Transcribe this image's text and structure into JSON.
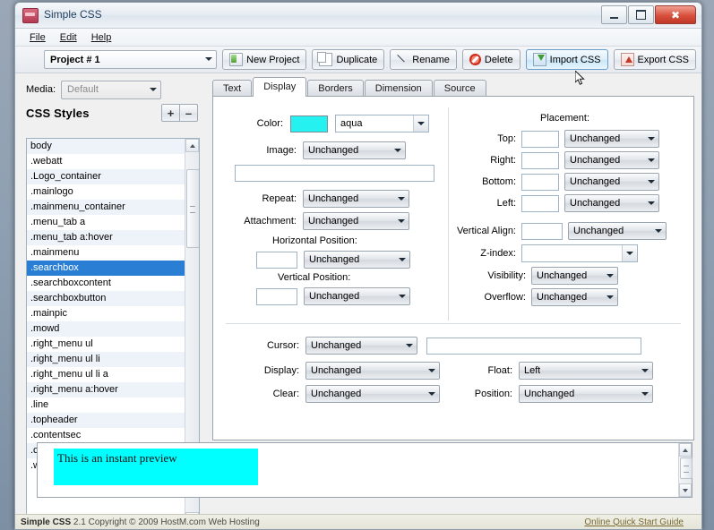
{
  "window": {
    "title": "Simple CSS",
    "app_icon": "app-icon",
    "minimize_label": "Minimize",
    "maximize_label": "Maximize",
    "close_label": "Close"
  },
  "menubar": {
    "items": [
      "File",
      "Edit",
      "Help"
    ]
  },
  "toolbar": {
    "project_value": "Project # 1",
    "buttons": [
      {
        "label": "New Project",
        "icon": "new-project-icon",
        "hover": false
      },
      {
        "label": "Duplicate",
        "icon": "duplicate-icon",
        "hover": false
      },
      {
        "label": "Rename",
        "icon": "rename-icon",
        "hover": false
      },
      {
        "label": "Delete",
        "icon": "delete-icon",
        "hover": false
      },
      {
        "label": "Import CSS",
        "icon": "import-icon",
        "hover": true
      },
      {
        "label": "Export CSS",
        "icon": "export-icon",
        "hover": false
      }
    ]
  },
  "sidebar": {
    "media_label": "Media:",
    "media_value": "Default",
    "styles_header": "CSS Styles",
    "add_label": "+",
    "remove_label": "–",
    "selected_style": ".searchbox",
    "items": [
      "body",
      ".webatt",
      ".Logo_container",
      ".mainlogo",
      ".mainmenu_container",
      ".menu_tab a",
      ".menu_tab a:hover",
      ".mainmenu",
      ".searchbox",
      ".searchboxcontent",
      ".searchboxbutton",
      ".mainpic",
      ".mowd",
      ".right_menu ul",
      ".right_menu ul li",
      ".right_menu ul li a",
      ".right_menu a:hover",
      ".line",
      ".topheader",
      ".contentsec",
      ".contentsecfont",
      ".welcome"
    ]
  },
  "tabs": {
    "items": [
      "Text",
      "Display",
      "Borders",
      "Dimension",
      "Source"
    ],
    "active": "Display"
  },
  "display_panel": {
    "color": {
      "label": "Color:",
      "swatch_hex": "#25f1f1",
      "value": "aqua"
    },
    "image": {
      "label": "Image:",
      "value": "Unchanged"
    },
    "image_url": {
      "value": ""
    },
    "repeat": {
      "label": "Repeat:",
      "value": "Unchanged"
    },
    "attachment": {
      "label": "Attachment:",
      "value": "Unchanged"
    },
    "horizontal_position": {
      "label": "Horizontal Position:",
      "number": "",
      "value": "Unchanged"
    },
    "vertical_position": {
      "label": "Vertical Position:",
      "number": "",
      "value": "Unchanged"
    },
    "placement": {
      "title": "Placement:",
      "rows": [
        {
          "label": "Top:",
          "number": "",
          "value": "Unchanged"
        },
        {
          "label": "Right:",
          "number": "",
          "value": "Unchanged"
        },
        {
          "label": "Bottom:",
          "number": "",
          "value": "Unchanged"
        },
        {
          "label": "Left:",
          "number": "",
          "value": "Unchanged"
        }
      ]
    },
    "vertical_align": {
      "label": "Vertical Align:",
      "number": "",
      "value": "Unchanged"
    },
    "z_index": {
      "label": "Z-index:",
      "value": ""
    },
    "visibility": {
      "label": "Visibility:",
      "value": "Unchanged"
    },
    "overflow": {
      "label": "Overflow:",
      "value": "Unchanged"
    },
    "cursor": {
      "label": "Cursor:",
      "value": "Unchanged",
      "text": ""
    },
    "display": {
      "label": "Display:",
      "value": "Unchanged"
    },
    "clear": {
      "label": "Clear:",
      "value": "Unchanged"
    },
    "float": {
      "label": "Float:",
      "value": "Left"
    },
    "position": {
      "label": "Position:",
      "value": "Unchanged"
    }
  },
  "preview": {
    "text": "This is an instant preview",
    "background_hex": "#00ffff"
  },
  "statusbar": {
    "app_name": "Simple CSS",
    "copyright": " 2.1 Copyright © 2009 HostM.com Web Hosting",
    "link": "Online Quick Start Guide"
  }
}
